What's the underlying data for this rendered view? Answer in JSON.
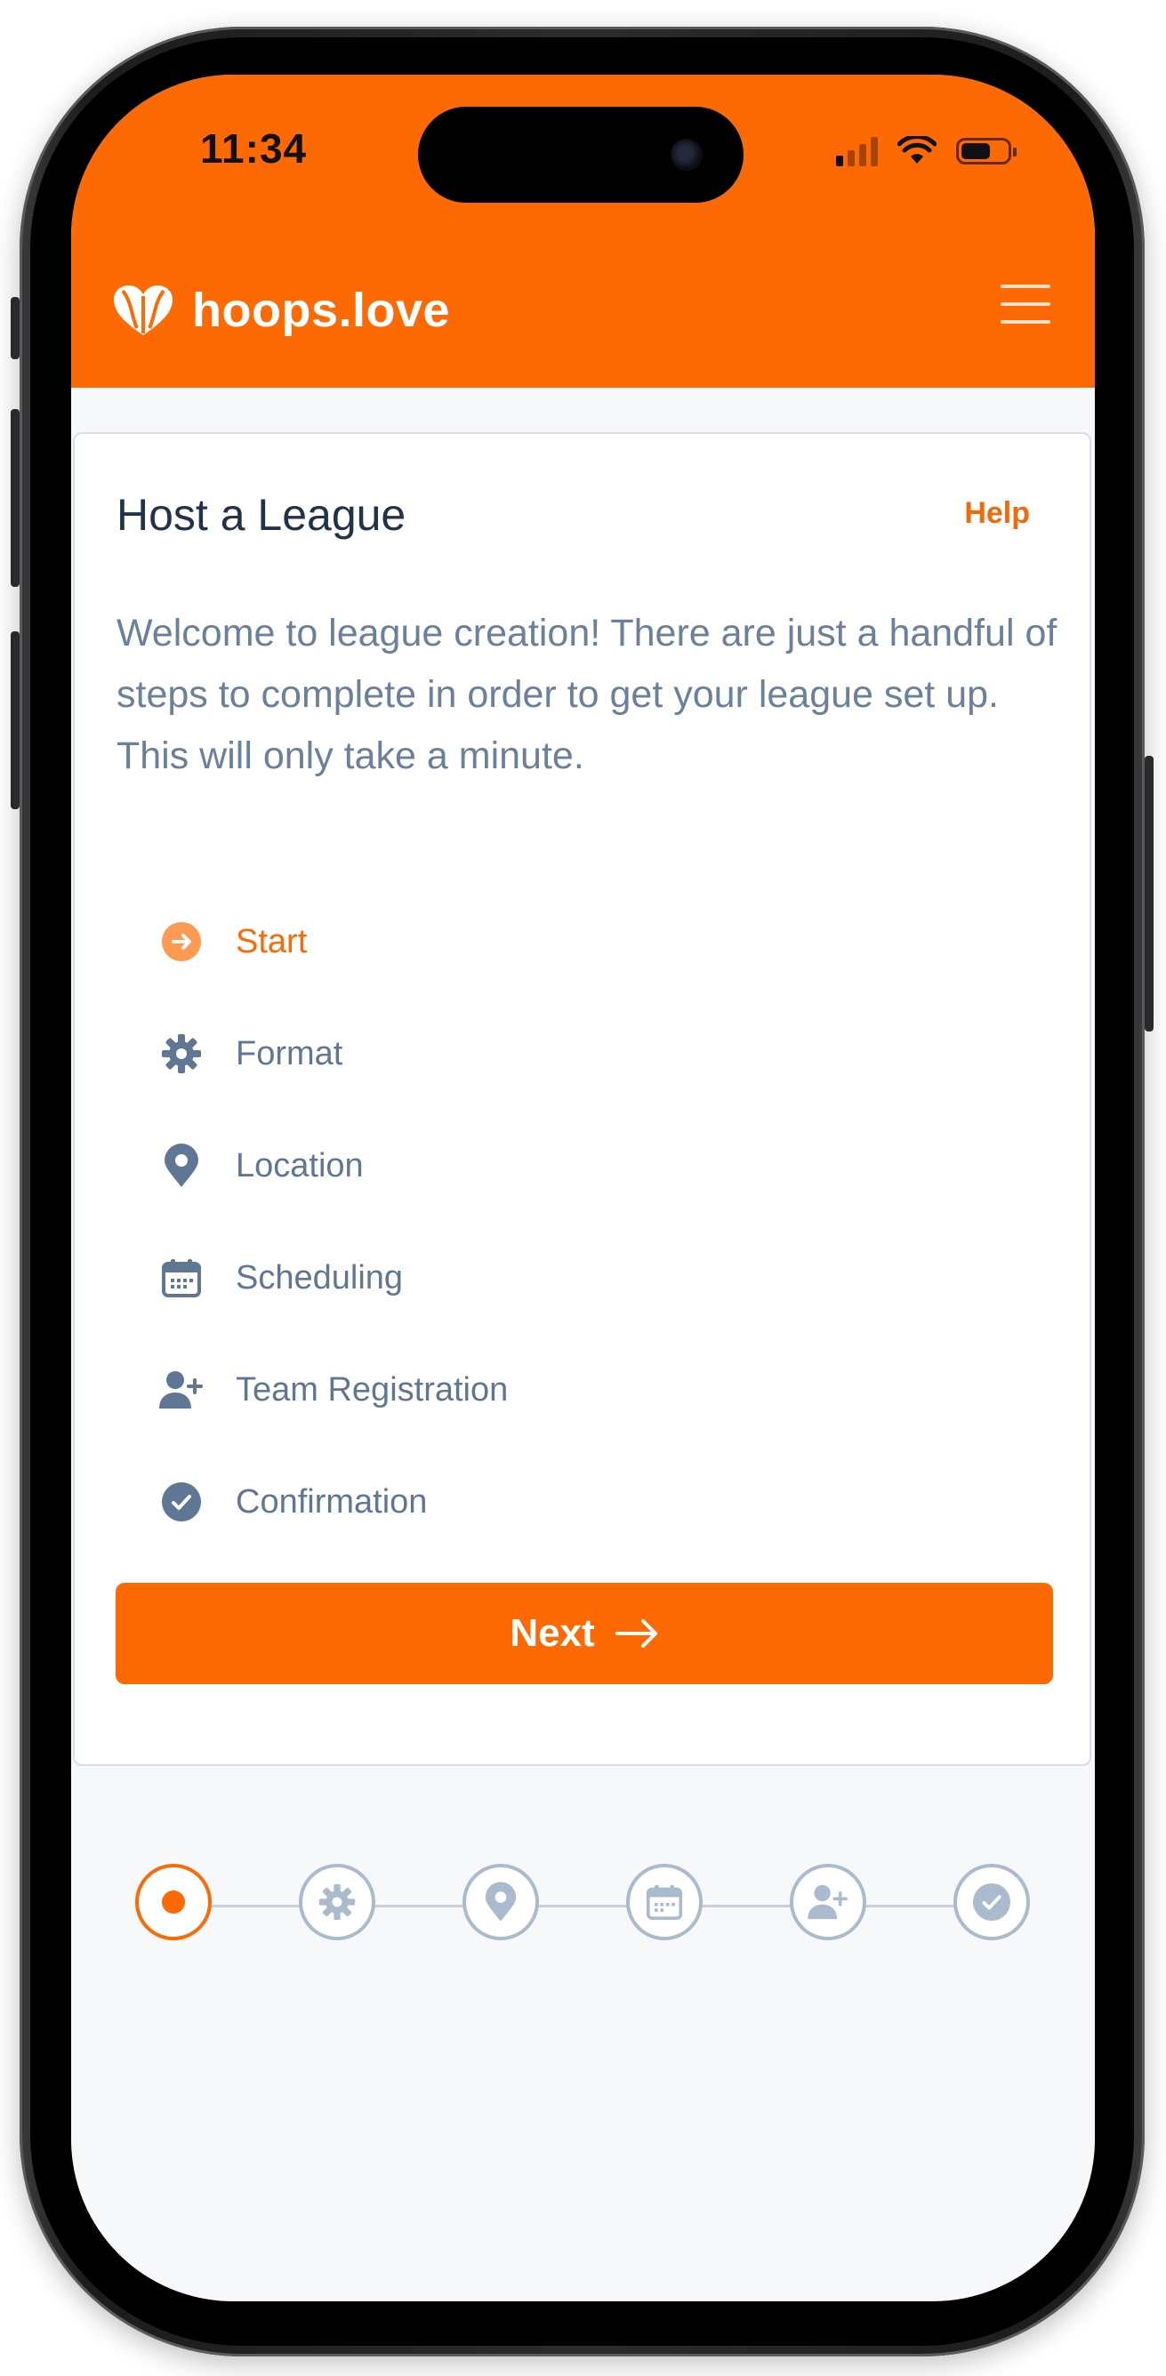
{
  "status_bar": {
    "time": "11:34"
  },
  "header": {
    "brand_name": "hoops.love",
    "menu_icon": "hamburger-menu-icon",
    "logo_icon": "basketball-heart-icon"
  },
  "colors": {
    "brand": "#fd6a03",
    "text_primary": "#213349",
    "text_muted": "#6a809b",
    "inactive": "#a9bbcc"
  },
  "card": {
    "title": "Host a League",
    "help_label": "Help",
    "intro": "Welcome to league creation! There are just a handful of steps to complete in order to get your league set up. This will only take a minute.",
    "steps": [
      {
        "label": "Start",
        "icon": "arrow-right-circle-icon",
        "active": true
      },
      {
        "label": "Format",
        "icon": "gear-icon",
        "active": false
      },
      {
        "label": "Location",
        "icon": "map-pin-icon",
        "active": false
      },
      {
        "label": "Scheduling",
        "icon": "calendar-icon",
        "active": false
      },
      {
        "label": "Team Registration",
        "icon": "add-user-icon",
        "active": false
      },
      {
        "label": "Confirmation",
        "icon": "check-circle-icon",
        "active": false
      }
    ],
    "next_label": "Next"
  },
  "progress": {
    "current_step": 1,
    "total_steps": 6
  }
}
